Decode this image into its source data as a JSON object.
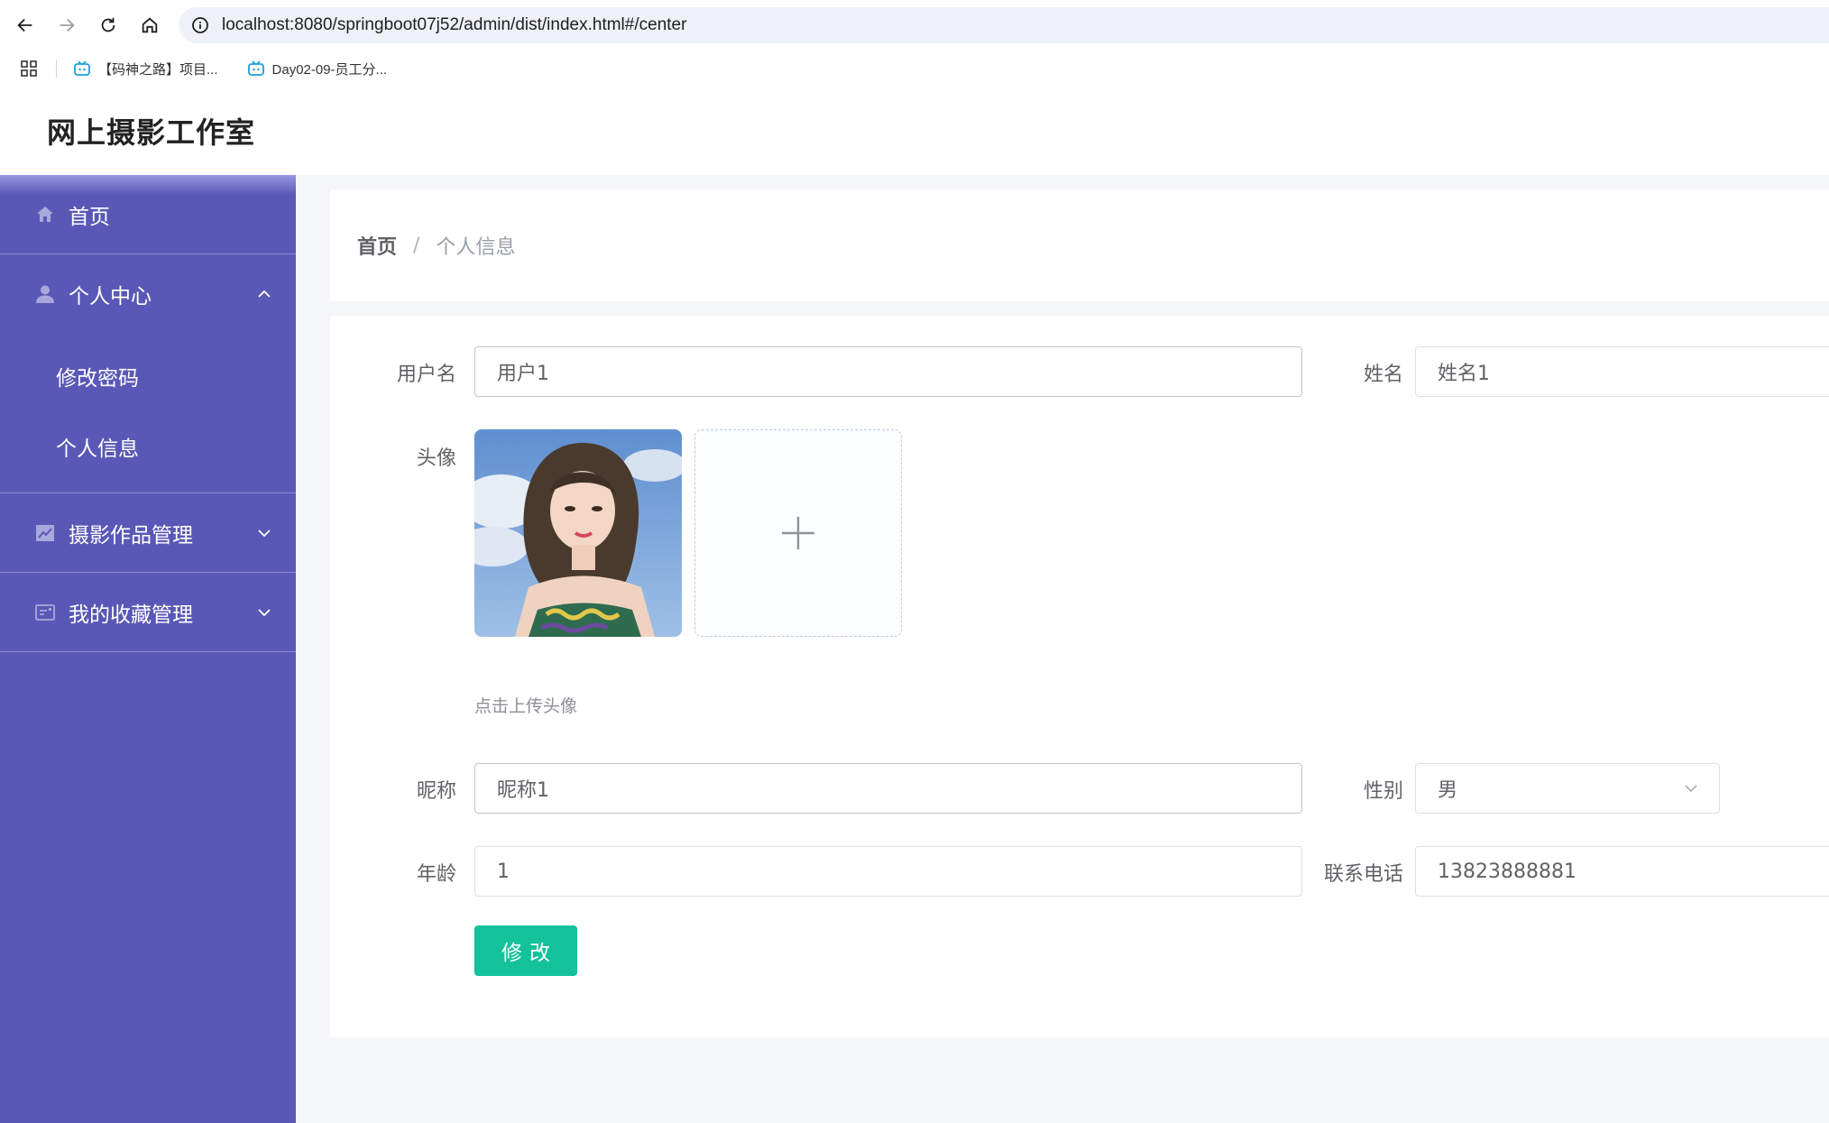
{
  "browser": {
    "url": "localhost:8080/springboot07j52/admin/dist/index.html#/center",
    "bookmarks": [
      {
        "label": "【码神之路】项目..."
      },
      {
        "label": "Day02-09-员工分..."
      }
    ]
  },
  "header": {
    "title": "网上摄影工作室"
  },
  "sidebar": {
    "home": "首页",
    "personal_center": "个人中心",
    "personal_sub": [
      "修改密码",
      "个人信息"
    ],
    "works_mgmt": "摄影作品管理",
    "favorites_mgmt": "我的收藏管理"
  },
  "breadcrumb": {
    "home": "首页",
    "separator": "/",
    "current": "个人信息"
  },
  "form": {
    "username_label": "用户名",
    "username_value": "用户1",
    "name_label": "姓名",
    "name_value": "姓名1",
    "avatar_label": "头像",
    "upload_tip": "点击上传头像",
    "nickname_label": "昵称",
    "nickname_value": "昵称1",
    "gender_label": "性别",
    "gender_value": "男",
    "age_label": "年龄",
    "age_value": "1",
    "phone_label": "联系电话",
    "phone_value": "13823888881",
    "submit_label": "修改"
  },
  "colors": {
    "sidebar_bg": "#5a58b6",
    "button_bg": "#13c29a"
  },
  "icons": {
    "home": "home-icon",
    "user": "user-icon",
    "chart": "chart-icon",
    "card": "card-icon",
    "plus": "plus-icon"
  }
}
